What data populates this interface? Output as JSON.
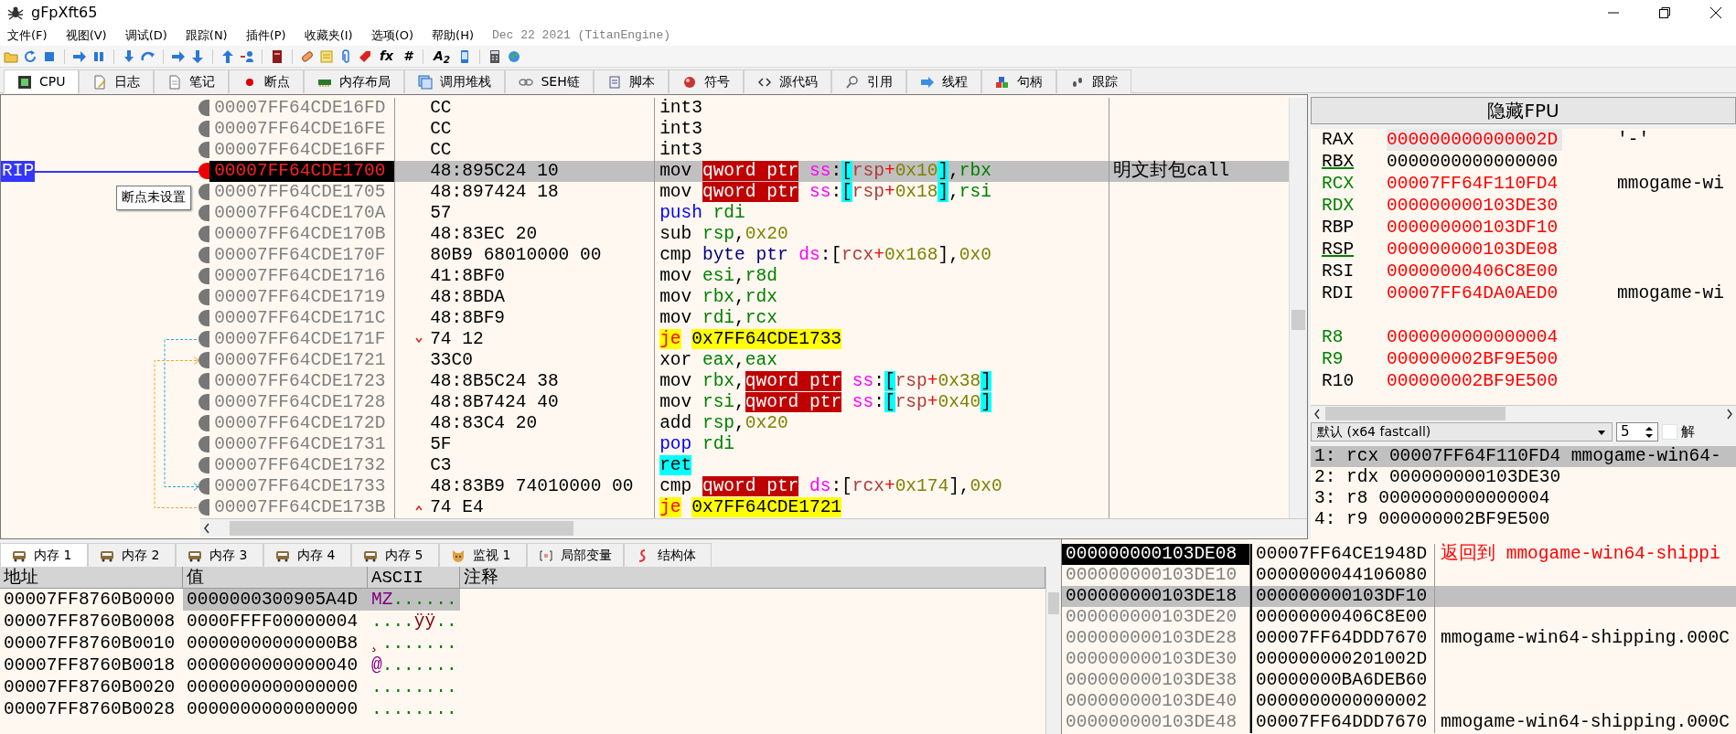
{
  "window": {
    "title": "gFpXft65"
  },
  "menu": [
    "文件(F)",
    "视图(V)",
    "调试(D)",
    "跟踪(N)",
    "插件(P)",
    "收藏夹(I)",
    "选项(O)",
    "帮助(H)"
  ],
  "build_info": "Dec 22 2021 (TitanEngine)",
  "toolbar": {
    "labels": [
      "fx",
      "#",
      "A$_{2}$"
    ]
  },
  "tabs": [
    {
      "label": "CPU",
      "selected": true
    },
    {
      "label": "日志",
      "selected": false
    },
    {
      "label": "笔记",
      "selected": false
    },
    {
      "label": "断点",
      "selected": false
    },
    {
      "label": "内存布局",
      "selected": false
    },
    {
      "label": "调用堆栈",
      "selected": false
    },
    {
      "label": "SEH链",
      "selected": false
    },
    {
      "label": "脚本",
      "selected": false
    },
    {
      "label": "符号",
      "selected": false
    },
    {
      "label": "源代码",
      "selected": false
    },
    {
      "label": "引用",
      "selected": false
    },
    {
      "label": "线程",
      "selected": false
    },
    {
      "label": "句柄",
      "selected": false
    },
    {
      "label": "跟踪",
      "selected": false
    }
  ],
  "disassembly": {
    "rip_label": "RIP",
    "tooltip": "断点未设置",
    "rows": [
      {
        "address": "00007FF64CDE16FD",
        "bytes": "CC",
        "kind": "plain",
        "breakpoint": false,
        "current": false,
        "selected": false,
        "tokens": [
          {
            "text": "int3",
            "kind": "mn"
          }
        ]
      },
      {
        "address": "00007FF64CDE16FE",
        "bytes": "CC",
        "kind": "plain",
        "breakpoint": false,
        "current": false,
        "selected": false,
        "tokens": [
          {
            "text": "int3",
            "kind": "mn"
          }
        ]
      },
      {
        "address": "00007FF64CDE16FF",
        "bytes": "CC",
        "kind": "plain",
        "breakpoint": false,
        "current": false,
        "selected": false,
        "tokens": [
          {
            "text": "int3",
            "kind": "mn"
          }
        ]
      },
      {
        "address": "00007FF64CDE1700",
        "bytes": "48:895C24 10",
        "kind": "plain",
        "breakpoint": true,
        "current": true,
        "selected": true,
        "tokens": [
          {
            "text": "mov ",
            "kind": "mn"
          },
          {
            "text": "qword ptr",
            "kind": "size"
          },
          {
            "text": " ss",
            "kind": "seg"
          },
          {
            "text": ":",
            "kind": "p"
          },
          {
            "text": "[",
            "kind": "br"
          },
          {
            "text": "rsp",
            "kind": "mreg"
          },
          {
            "text": "+",
            "kind": "op"
          },
          {
            "text": "0x10",
            "kind": "num"
          },
          {
            "text": "]",
            "kind": "br"
          },
          {
            "text": ",",
            "kind": "p"
          },
          {
            "text": "rbx",
            "kind": "reg"
          }
        ],
        "comment": "明文封包call"
      },
      {
        "address": "00007FF64CDE1705",
        "bytes": "48:897424 18",
        "kind": "plain",
        "breakpoint": false,
        "current": false,
        "selected": false,
        "tokens": [
          {
            "text": "mov ",
            "kind": "mn"
          },
          {
            "text": "qword ptr",
            "kind": "size"
          },
          {
            "text": " ss",
            "kind": "seg"
          },
          {
            "text": ":",
            "kind": "p"
          },
          {
            "text": "[",
            "kind": "br"
          },
          {
            "text": "rsp",
            "kind": "mreg"
          },
          {
            "text": "+",
            "kind": "op"
          },
          {
            "text": "0x18",
            "kind": "num"
          },
          {
            "text": "]",
            "kind": "br"
          },
          {
            "text": ",",
            "kind": "p"
          },
          {
            "text": "rsi",
            "kind": "reg"
          }
        ]
      },
      {
        "address": "00007FF64CDE170A",
        "bytes": "57",
        "kind": "plain",
        "breakpoint": false,
        "current": false,
        "selected": false,
        "tokens": [
          {
            "text": "push",
            "kind": "push"
          },
          {
            "text": " rdi",
            "kind": "reg"
          }
        ]
      },
      {
        "address": "00007FF64CDE170B",
        "bytes": "48:83EC 20",
        "kind": "plain",
        "breakpoint": false,
        "current": false,
        "selected": false,
        "tokens": [
          {
            "text": "sub ",
            "kind": "mn"
          },
          {
            "text": "rsp",
            "kind": "reg"
          },
          {
            "text": ",",
            "kind": "p"
          },
          {
            "text": "0x20",
            "kind": "num"
          }
        ]
      },
      {
        "address": "00007FF64CDE170F",
        "bytes": "80B9 68010000 00",
        "kind": "plain",
        "breakpoint": false,
        "current": false,
        "selected": false,
        "tokens": [
          {
            "text": "cmp ",
            "kind": "mn"
          },
          {
            "text": "byte ptr",
            "kind": "bptr"
          },
          {
            "text": " ds",
            "kind": "seg"
          },
          {
            "text": ":",
            "kind": "p"
          },
          {
            "text": "[",
            "kind": "p"
          },
          {
            "text": "rcx",
            "kind": "mreg"
          },
          {
            "text": "+",
            "kind": "op"
          },
          {
            "text": "0x168",
            "kind": "num"
          },
          {
            "text": "]",
            "kind": "p"
          },
          {
            "text": ",",
            "kind": "p"
          },
          {
            "text": "0x0",
            "kind": "num"
          }
        ]
      },
      {
        "address": "00007FF64CDE1716",
        "bytes": "41:8BF0",
        "kind": "plain",
        "breakpoint": false,
        "current": false,
        "selected": false,
        "tokens": [
          {
            "text": "mov ",
            "kind": "mn"
          },
          {
            "text": "esi",
            "kind": "reg"
          },
          {
            "text": ",",
            "kind": "p"
          },
          {
            "text": "r8d",
            "kind": "reg"
          }
        ]
      },
      {
        "address": "00007FF64CDE1719",
        "bytes": "48:8BDA",
        "kind": "plain",
        "breakpoint": false,
        "current": false,
        "selected": false,
        "tokens": [
          {
            "text": "mov ",
            "kind": "mn"
          },
          {
            "text": "rbx",
            "kind": "reg"
          },
          {
            "text": ",",
            "kind": "p"
          },
          {
            "text": "rdx",
            "kind": "reg"
          }
        ]
      },
      {
        "address": "00007FF64CDE171C",
        "bytes": "48:8BF9",
        "kind": "plain",
        "breakpoint": false,
        "current": false,
        "selected": false,
        "tokens": [
          {
            "text": "mov ",
            "kind": "mn"
          },
          {
            "text": "rdi",
            "kind": "reg"
          },
          {
            "text": ",",
            "kind": "p"
          },
          {
            "text": "rcx",
            "kind": "reg"
          }
        ]
      },
      {
        "address": "00007FF64CDE171F",
        "bytes": "74 12",
        "kind": "jump-down",
        "breakpoint": false,
        "current": false,
        "selected": false,
        "tokens": [
          {
            "text": "je",
            "kind": "jcc"
          },
          {
            "text": "0x7FF64CDE1733",
            "kind": "addr"
          }
        ]
      },
      {
        "address": "00007FF64CDE1721",
        "bytes": "33C0",
        "kind": "plain",
        "breakpoint": false,
        "current": false,
        "selected": false,
        "tokens": [
          {
            "text": "xor ",
            "kind": "mn"
          },
          {
            "text": "eax",
            "kind": "reg"
          },
          {
            "text": ",",
            "kind": "p"
          },
          {
            "text": "eax",
            "kind": "reg"
          }
        ]
      },
      {
        "address": "00007FF64CDE1723",
        "bytes": "48:8B5C24 38",
        "kind": "plain",
        "breakpoint": false,
        "current": false,
        "selected": false,
        "tokens": [
          {
            "text": "mov ",
            "kind": "mn"
          },
          {
            "text": "rbx",
            "kind": "reg"
          },
          {
            "text": ",",
            "kind": "p"
          },
          {
            "text": "qword ptr",
            "kind": "size"
          },
          {
            "text": " ss",
            "kind": "seg"
          },
          {
            "text": ":",
            "kind": "p"
          },
          {
            "text": "[",
            "kind": "br"
          },
          {
            "text": "rsp",
            "kind": "mreg"
          },
          {
            "text": "+",
            "kind": "op"
          },
          {
            "text": "0x38",
            "kind": "num"
          },
          {
            "text": "]",
            "kind": "br"
          }
        ]
      },
      {
        "address": "00007FF64CDE1728",
        "bytes": "48:8B7424 40",
        "kind": "plain",
        "breakpoint": false,
        "current": false,
        "selected": false,
        "tokens": [
          {
            "text": "mov ",
            "kind": "mn"
          },
          {
            "text": "rsi",
            "kind": "reg"
          },
          {
            "text": ",",
            "kind": "p"
          },
          {
            "text": "qword ptr",
            "kind": "size"
          },
          {
            "text": " ss",
            "kind": "seg"
          },
          {
            "text": ":",
            "kind": "p"
          },
          {
            "text": "[",
            "kind": "br"
          },
          {
            "text": "rsp",
            "kind": "mreg"
          },
          {
            "text": "+",
            "kind": "op"
          },
          {
            "text": "0x40",
            "kind": "num"
          },
          {
            "text": "]",
            "kind": "br"
          }
        ]
      },
      {
        "address": "00007FF64CDE172D",
        "bytes": "48:83C4 20",
        "kind": "plain",
        "breakpoint": false,
        "current": false,
        "selected": false,
        "tokens": [
          {
            "text": "add ",
            "kind": "mn"
          },
          {
            "text": "rsp",
            "kind": "reg"
          },
          {
            "text": ",",
            "kind": "p"
          },
          {
            "text": "0x20",
            "kind": "num"
          }
        ]
      },
      {
        "address": "00007FF64CDE1731",
        "bytes": "5F",
        "kind": "plain",
        "breakpoint": false,
        "current": false,
        "selected": false,
        "tokens": [
          {
            "text": "pop",
            "kind": "push"
          },
          {
            "text": " rdi",
            "kind": "reg"
          }
        ]
      },
      {
        "address": "00007FF64CDE1732",
        "bytes": "C3",
        "kind": "plain",
        "breakpoint": false,
        "current": false,
        "selected": false,
        "tokens": [
          {
            "text": "ret",
            "kind": "ret"
          }
        ]
      },
      {
        "address": "00007FF64CDE1733",
        "bytes": "48:83B9 74010000 00",
        "kind": "plain",
        "breakpoint": false,
        "current": false,
        "selected": false,
        "tokens": [
          {
            "text": "cmp ",
            "kind": "mn"
          },
          {
            "text": "qword ptr",
            "kind": "size"
          },
          {
            "text": " ds",
            "kind": "seg"
          },
          {
            "text": ":",
            "kind": "p"
          },
          {
            "text": "[",
            "kind": "p"
          },
          {
            "text": "rcx",
            "kind": "mreg"
          },
          {
            "text": "+",
            "kind": "op"
          },
          {
            "text": "0x174",
            "kind": "num"
          },
          {
            "text": "]",
            "kind": "p"
          },
          {
            "text": ",",
            "kind": "p"
          },
          {
            "text": "0x0",
            "kind": "num"
          }
        ]
      },
      {
        "address": "00007FF64CDE173B",
        "bytes": "74 E4",
        "kind": "jump-up",
        "breakpoint": false,
        "current": false,
        "selected": false,
        "tokens": [
          {
            "text": "je",
            "kind": "jcc"
          },
          {
            "text": "0x7FF64CDE1721",
            "kind": "addr"
          }
        ]
      }
    ]
  },
  "registers": {
    "header": "隐藏FPU",
    "groups": [
      [
        {
          "name": "RAX",
          "value": "000000000000002D",
          "comment": "'-'",
          "name_changed": false,
          "marked": false,
          "value_changed": true,
          "selected": true
        },
        {
          "name": "RBX",
          "value": "0000000000000000",
          "name_changed": false,
          "marked": true,
          "value_changed": false,
          "selected": false
        },
        {
          "name": "RCX",
          "value": "00007FF64F110FD4",
          "comment": "mmogame-wi",
          "name_changed": true,
          "marked": false,
          "value_changed": true,
          "selected": false
        },
        {
          "name": "RDX",
          "value": "000000000103DE30",
          "name_changed": true,
          "marked": false,
          "value_changed": true,
          "selected": false
        },
        {
          "name": "RBP",
          "value": "000000000103DF10",
          "name_changed": false,
          "marked": false,
          "value_changed": true,
          "selected": false
        },
        {
          "name": "RSP",
          "value": "000000000103DE08",
          "name_changed": false,
          "marked": true,
          "value_changed": true,
          "selected": false
        },
        {
          "name": "RSI",
          "value": "00000000406C8E00",
          "name_changed": false,
          "marked": false,
          "value_changed": true,
          "selected": false
        },
        {
          "name": "RDI",
          "value": "00007FF64DA0AED0",
          "comment": "mmogame-wi",
          "name_changed": false,
          "marked": false,
          "value_changed": true,
          "selected": false
        }
      ],
      [
        {
          "name": "R8",
          "value": "0000000000000004",
          "name_changed": true,
          "marked": false,
          "value_changed": true,
          "selected": false
        },
        {
          "name": "R9",
          "value": "000000002BF9E500",
          "name_changed": true,
          "marked": false,
          "value_changed": true,
          "selected": false
        },
        {
          "name": "R10",
          "value": "000000002BF9E500",
          "name_changed": false,
          "marked": false,
          "value_changed": true,
          "selected": false
        }
      ]
    ],
    "convention": "默认 (x64 fastcall)",
    "arg_count": "5",
    "unlock": {
      "label": "解",
      "checked": false
    },
    "args": [
      {
        "text": "1: rcx 00007FF64F110FD4 mmogame-win64-",
        "selected": true
      },
      {
        "text": "2: rdx 000000000103DE30",
        "selected": false
      },
      {
        "text": "3: r8 0000000000000004",
        "selected": false
      },
      {
        "text": "4: r9 000000002BF9E500",
        "selected": false
      }
    ]
  },
  "memory_tabs": [
    {
      "label": "内存 1",
      "selected": true
    },
    {
      "label": "内存 2",
      "selected": false
    },
    {
      "label": "内存 3",
      "selected": false
    },
    {
      "label": "内存 4",
      "selected": false
    },
    {
      "label": "内存 5",
      "selected": false
    },
    {
      "label": "监视 1",
      "selected": false
    },
    {
      "label": "局部变量",
      "selected": false
    },
    {
      "label": "结构体",
      "selected": false
    }
  ],
  "memory": {
    "columns": [
      "地址",
      "值",
      "ASCII",
      "注释"
    ],
    "rows": [
      {
        "address": "00007FF8760B0000",
        "value": "0000000300905A4D",
        "ascii": [
          {
            "text": "MZ",
            "kind": "p"
          },
          {
            "text": "......",
            "kind": "d"
          }
        ],
        "selected": true
      },
      {
        "address": "00007FF8760B0008",
        "value": "0000FFFF00000004",
        "ascii": [
          {
            "text": "....",
            "kind": "d"
          },
          {
            "text": "ÿÿ",
            "kind": "x"
          },
          {
            "text": "..",
            "kind": "d"
          }
        ],
        "selected": false
      },
      {
        "address": "00007FF8760B0010",
        "value": "00000000000000B8",
        "ascii": [
          {
            "text": "¸",
            "kind": "x"
          },
          {
            "text": ".......",
            "kind": "d"
          }
        ],
        "selected": false
      },
      {
        "address": "00007FF8760B0018",
        "value": "0000000000000040",
        "ascii": [
          {
            "text": "@",
            "kind": "p"
          },
          {
            "text": ".......",
            "kind": "d"
          }
        ],
        "selected": false
      },
      {
        "address": "00007FF8760B0020",
        "value": "0000000000000000",
        "ascii": [
          {
            "text": "........",
            "kind": "d"
          }
        ],
        "selected": false
      },
      {
        "address": "00007FF8760B0028",
        "value": "0000000000000000",
        "ascii": [
          {
            "text": "........",
            "kind": "d"
          }
        ],
        "selected": false
      }
    ]
  },
  "stack": {
    "rows": [
      {
        "address": "000000000103DE08",
        "value": "00007FF64CE1948D",
        "comment": {
          "text": "返回到 mmogame-win64-shippi",
          "kind": "return"
        },
        "current": true,
        "selected": false
      },
      {
        "address": "000000000103DE10",
        "value": "0000000044106080",
        "current": false,
        "selected": false
      },
      {
        "address": "000000000103DE18",
        "value": "000000000103DF10",
        "current": false,
        "selected": true
      },
      {
        "address": "000000000103DE20",
        "value": "00000000406C8E00",
        "current": false,
        "selected": false
      },
      {
        "address": "000000000103DE28",
        "value": "00007FF64DDD7670",
        "comment": {
          "text": "mmogame-win64-shipping.000C",
          "kind": "symbol"
        },
        "current": false,
        "selected": false
      },
      {
        "address": "000000000103DE30",
        "value": "000000000201002D",
        "current": false,
        "selected": false
      },
      {
        "address": "000000000103DE38",
        "value": "00000000BA6DEB60",
        "current": false,
        "selected": false
      },
      {
        "address": "000000000103DE40",
        "value": "0000000000000002",
        "current": false,
        "selected": false
      },
      {
        "address": "000000000103DE48",
        "value": "00007FF64DDD7670",
        "comment": {
          "text": "mmogame-win64-shipping.000C",
          "kind": "symbol"
        },
        "current": false,
        "selected": false
      }
    ]
  }
}
